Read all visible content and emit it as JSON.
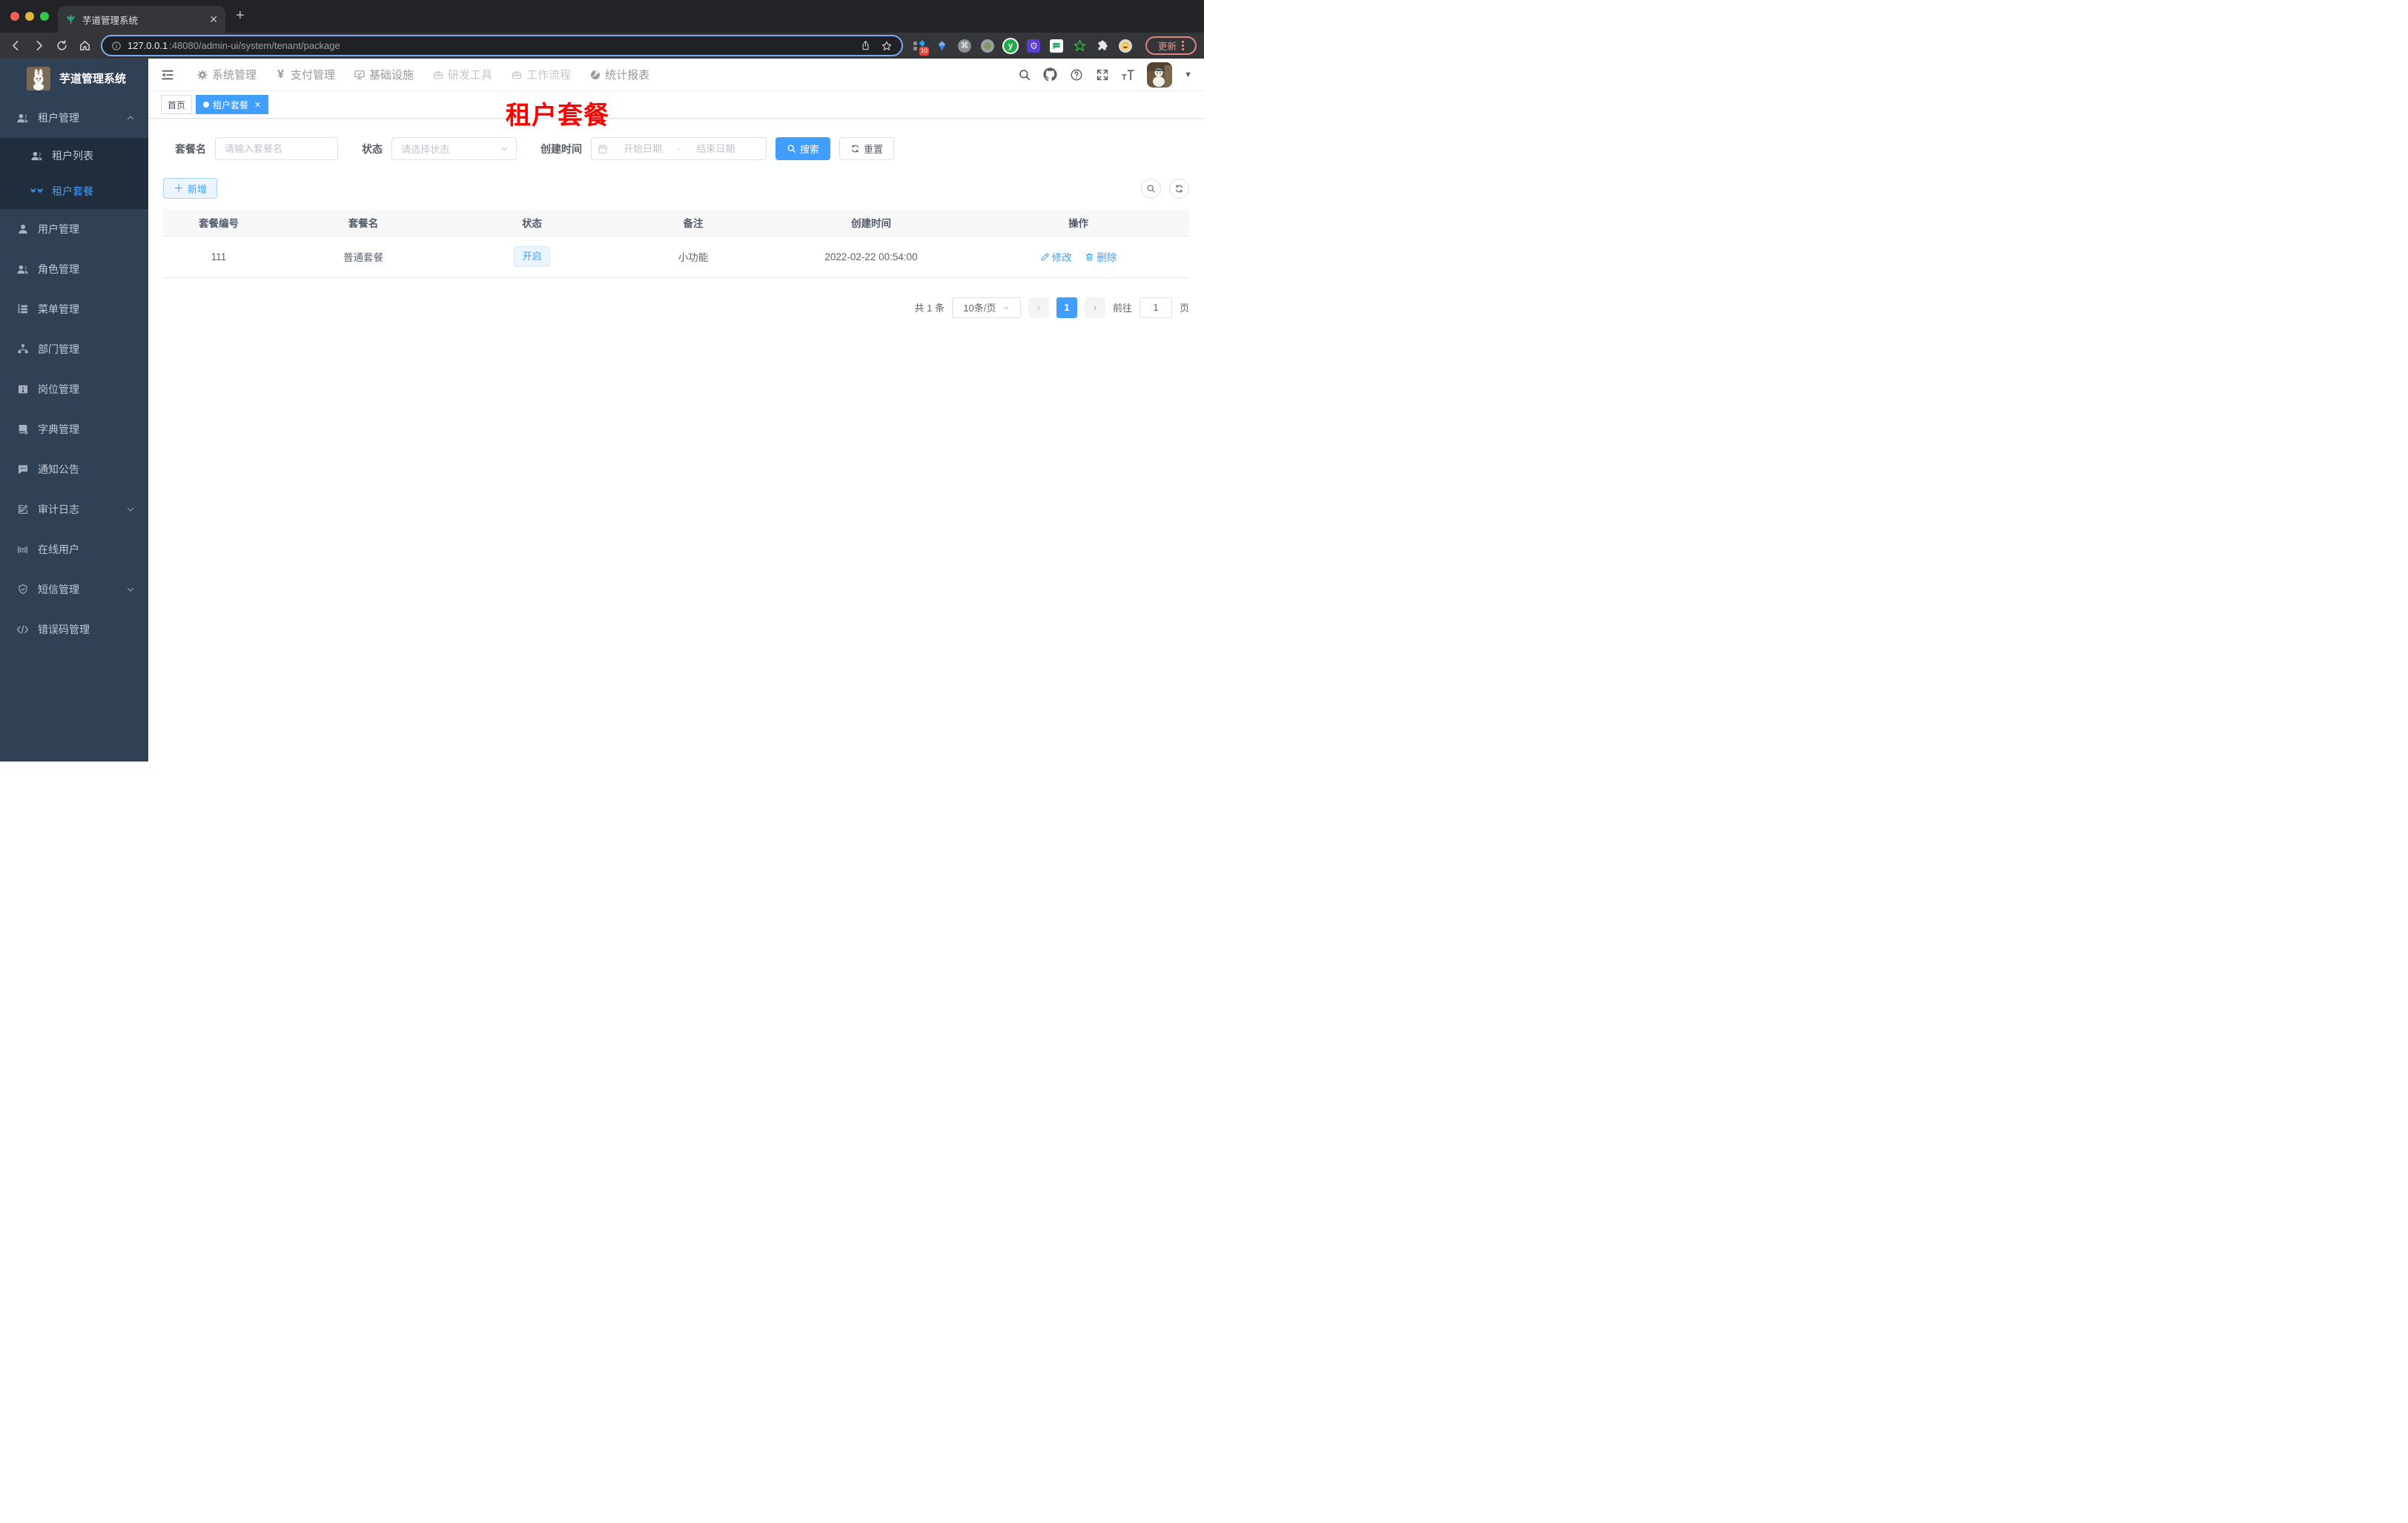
{
  "colors": {
    "primary": "#409eff",
    "sidebar_bg": "#304156",
    "submenu_bg": "#1f2d3d",
    "annotation_red": "#fe0000",
    "update_button": "#ec928b",
    "status_tag_bg": "#ecf5ff"
  },
  "browser": {
    "tab_title": "芋道管理系统",
    "url_host": "127.0.0.1",
    "url_path": ":48080/admin-ui/system/tenant/package",
    "extension_badge": "10",
    "update_label": "更新"
  },
  "sidebar": {
    "logo_title": "芋道管理系统",
    "items": [
      {
        "label": "租户管理",
        "icon": "peoples-icon"
      },
      {
        "label": "租户列表",
        "icon": "peoples-icon"
      },
      {
        "label": "租户套餐",
        "icon": "lashes-icon"
      },
      {
        "label": "用户管理",
        "icon": "user-icon"
      },
      {
        "label": "角色管理",
        "icon": "peoples-icon"
      },
      {
        "label": "菜单管理",
        "icon": "tree-table-icon"
      },
      {
        "label": "部门管理",
        "icon": "org-tree-icon"
      },
      {
        "label": "岗位管理",
        "icon": "post-icon"
      },
      {
        "label": "字典管理",
        "icon": "dictionary-icon"
      },
      {
        "label": "通知公告",
        "icon": "message-icon"
      },
      {
        "label": "审计日志",
        "icon": "log-icon"
      },
      {
        "label": "在线用户",
        "icon": "online-icon"
      },
      {
        "label": "短信管理",
        "icon": "shield-icon"
      },
      {
        "label": "错误码管理",
        "icon": "code-icon"
      }
    ]
  },
  "top_nav": {
    "items": [
      {
        "label": "系统管理",
        "icon": "gear-icon"
      },
      {
        "label": "支付管理",
        "icon": "yen-icon"
      },
      {
        "label": "基础设施",
        "icon": "monitor-icon"
      },
      {
        "label": "研发工具",
        "icon": "toolbox-icon"
      },
      {
        "label": "工作流程",
        "icon": "workflow-icon"
      },
      {
        "label": "统计报表",
        "icon": "chart-icon"
      }
    ]
  },
  "tags": {
    "home": "首页",
    "active": "租户套餐"
  },
  "annotation": "租户套餐",
  "filters": {
    "name_label": "套餐名",
    "name_placeholder": "请输入套餐名",
    "status_label": "状态",
    "status_placeholder": "请选择状态",
    "time_label": "创建时间",
    "start_placeholder": "开始日期",
    "separator": "-",
    "end_placeholder": "结束日期",
    "search_label": "搜索",
    "reset_label": "重置"
  },
  "actions": {
    "add_label": "新增"
  },
  "table": {
    "columns": [
      "套餐编号",
      "套餐名",
      "状态",
      "备注",
      "创建时间",
      "操作"
    ],
    "row": {
      "id": "111",
      "name": "普通套餐",
      "status": "开启",
      "remark": "小功能",
      "created": "2022-02-22 00:54:00",
      "edit": "修改",
      "remove": "删除"
    }
  },
  "pagination": {
    "total": "共 1 条",
    "page_size": "10条/页",
    "page": "1",
    "goto_label": "前往",
    "goto_value": "1",
    "unit_label": "页"
  }
}
